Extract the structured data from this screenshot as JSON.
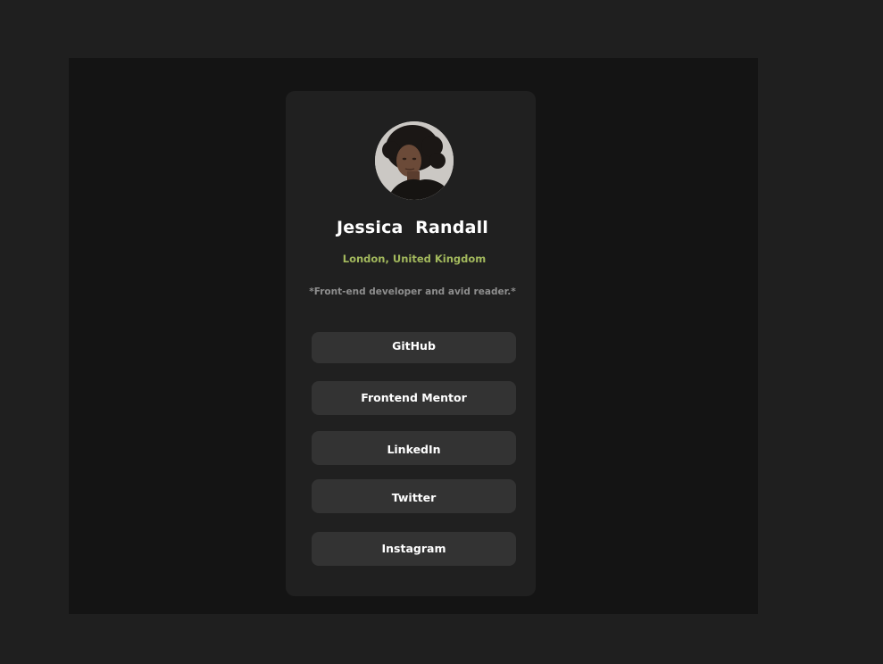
{
  "profile": {
    "name": "Jessica  Randall",
    "location": "London, United Kingdom",
    "bio": "*Front-end developer and avid reader.*",
    "avatar_icon": "profile-photo"
  },
  "links": [
    {
      "label": "GitHub"
    },
    {
      "label": "Frontend Mentor"
    },
    {
      "label": "LinkedIn"
    },
    {
      "label": "Twitter"
    },
    {
      "label": "Instagram"
    }
  ],
  "colors": {
    "page_background": "#1f1f1f",
    "stage_background": "#141414",
    "card_background": "#202020",
    "button_background": "#333333",
    "accent": "#a3b95d",
    "text": "#ffffff",
    "muted_text": "#8e8e8e"
  }
}
